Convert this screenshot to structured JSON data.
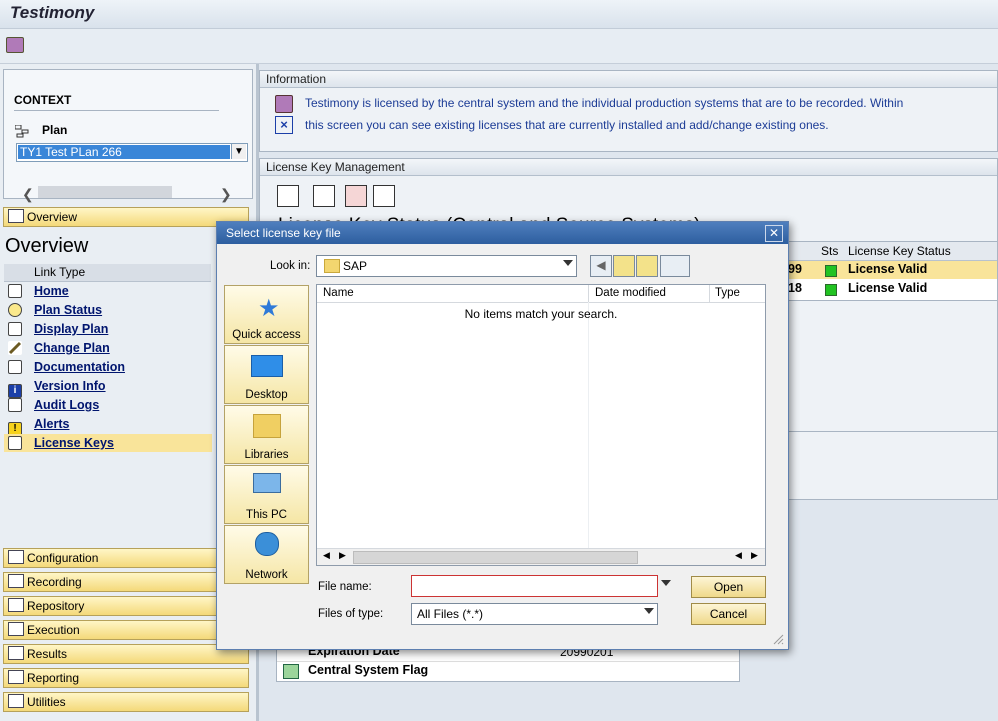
{
  "app": {
    "title": "Testimony"
  },
  "context": {
    "heading": "CONTEXT",
    "plan_label": "Plan",
    "plan_value": "TY1 Test PLan 266"
  },
  "nav": {
    "overview_tab": "Overview",
    "overview_title": "Overview",
    "link_type_header": "Link Type",
    "links": [
      {
        "label": "Home",
        "icon": "home-icon"
      },
      {
        "label": "Plan Status",
        "icon": "plan-status-icon"
      },
      {
        "label": "Display Plan",
        "icon": "display-plan-icon"
      },
      {
        "label": "Change Plan",
        "icon": "pencil-icon"
      },
      {
        "label": "Documentation",
        "icon": "documentation-icon"
      },
      {
        "label": "Version Info",
        "icon": "info-icon"
      },
      {
        "label": "Audit Logs",
        "icon": "audit-log-icon"
      },
      {
        "label": "Alerts",
        "icon": "alert-icon"
      },
      {
        "label": "License Keys",
        "icon": "license-key-icon"
      }
    ],
    "sections": [
      "Configuration",
      "Recording",
      "Repository",
      "Execution",
      "Results",
      "Reporting",
      "Utilities"
    ]
  },
  "info": {
    "title": "Information",
    "line1": "Testimony is licensed by the central system and the individual production systems that are to be recorded. Within",
    "line2": "this screen you can see existing licenses that are currently installed and add/change existing ones."
  },
  "lkm": {
    "title": "License Key Management",
    "heading_partial": "License Key Status (Central and Source Systems)",
    "col_sts": "Sts",
    "col_status": "License Key Status",
    "rows": [
      {
        "num": "99",
        "status": "License Valid",
        "status_color": "#22c322"
      },
      {
        "num": "18",
        "status": "License Valid",
        "status_color": "#22c322"
      }
    ],
    "bottom_rows": [
      {
        "label": "Expiration Date",
        "value": "20990201"
      },
      {
        "label": "Central System Flag",
        "value": ""
      }
    ]
  },
  "dialog": {
    "title": "Select license key file",
    "look_in_label": "Look in:",
    "look_in_value": "SAP",
    "places": [
      "Quick access",
      "Desktop",
      "Libraries",
      "This PC",
      "Network"
    ],
    "columns": [
      "Name",
      "Date modified",
      "Type"
    ],
    "empty_message": "No items match your search.",
    "file_name_label": "File name:",
    "file_name_value": "",
    "files_of_type_label": "Files of type:",
    "files_of_type_value": "All Files (*.*)",
    "open_label": "Open",
    "cancel_label": "Cancel"
  }
}
